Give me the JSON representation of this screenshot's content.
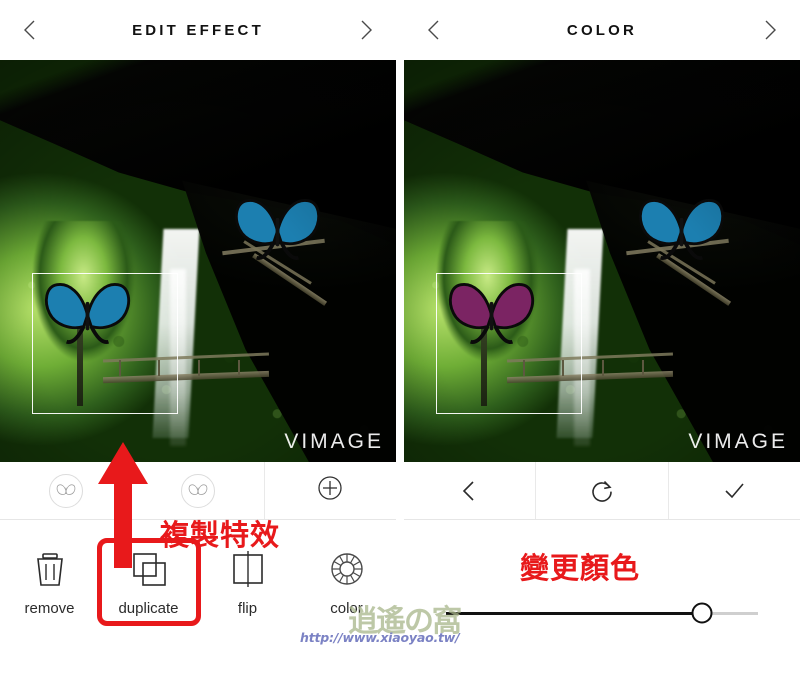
{
  "panels": {
    "left": {
      "header": {
        "title": "EDIT EFFECT",
        "prev_icon": "chevron-left-icon",
        "next_icon": "chevron-right-icon"
      },
      "photo": {
        "watermark": "VIMAGE",
        "scene": "waterfall-cave-forest",
        "effects": [
          {
            "name": "butterfly-top",
            "color": "#1c7fb0"
          },
          {
            "name": "butterfly-selected",
            "color": "#1c7fb0"
          }
        ],
        "selection_label": "selection-box"
      },
      "layers": [
        {
          "icon": "butterfly-icon",
          "label": "effect-layer-1",
          "selected": false
        },
        {
          "icon": "butterfly-icon",
          "label": "effect-layer-2",
          "selected": true
        },
        {
          "icon": "plus-icon",
          "label": "add-effect",
          "selected": false
        }
      ],
      "tools": [
        {
          "label": "remove",
          "icon": "trash-icon",
          "highlighted": false
        },
        {
          "label": "duplicate",
          "icon": "duplicate-icon",
          "highlighted": true
        },
        {
          "label": "flip",
          "icon": "flip-icon",
          "highlighted": false
        },
        {
          "label": "color",
          "icon": "color-wheel-icon",
          "highlighted": false
        }
      ]
    },
    "right": {
      "header": {
        "title": "COLOR",
        "prev_icon": "chevron-left-icon",
        "next_icon": "chevron-right-icon"
      },
      "photo": {
        "watermark": "VIMAGE",
        "scene": "waterfall-cave-forest",
        "effects": [
          {
            "name": "butterfly-top",
            "color": "#1c7fb0"
          },
          {
            "name": "butterfly-selected",
            "color": "#7b2463"
          }
        ],
        "selection_label": "selection-box"
      },
      "actions": [
        {
          "label": "back",
          "icon": "chevron-left-icon"
        },
        {
          "label": "reset",
          "icon": "reset-circular-arrow-icon"
        },
        {
          "label": "apply",
          "icon": "checkmark-icon"
        }
      ],
      "slider": {
        "name": "hue-slider",
        "value_percent": 82,
        "track_color": "#111111",
        "knob_color": "#ffffff"
      }
    }
  },
  "annotations": {
    "duplicate_note": "複製特效",
    "color_note": "變更顏色",
    "arrow": "red-up-arrow",
    "color_hex": "#e8191b"
  },
  "watermark": {
    "logo": "逍遙の窩",
    "url": "http://www.xiaoyao.tw/"
  }
}
